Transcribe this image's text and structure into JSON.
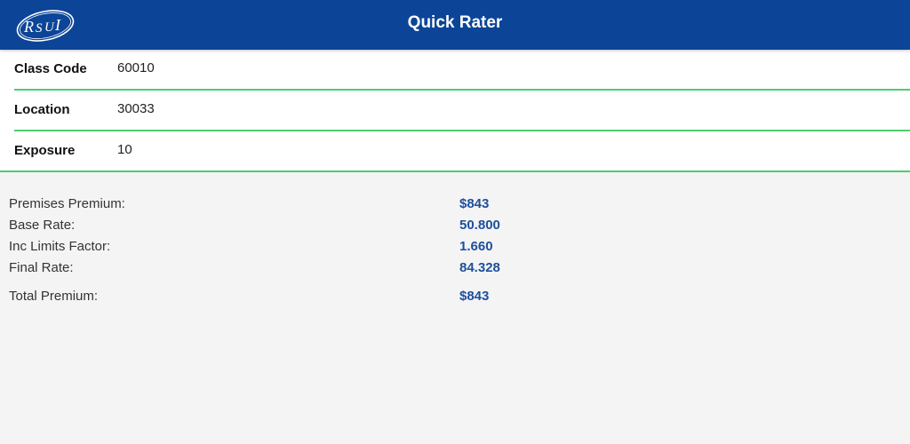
{
  "header": {
    "logo_text": "RSUI",
    "title": "Quick Rater"
  },
  "inputs": [
    {
      "label": "Class Code",
      "value": "60010"
    },
    {
      "label": "Location",
      "value": "30033"
    },
    {
      "label": "Exposure",
      "value": "10"
    }
  ],
  "results": {
    "premises_premium": {
      "label": "Premises Premium:",
      "value": "$843"
    },
    "base_rate": {
      "label": "Base Rate:",
      "value": "50.800"
    },
    "inc_limits_factor": {
      "label": "Inc Limits Factor:",
      "value": "1.660"
    },
    "final_rate": {
      "label": "Final Rate:",
      "value": "84.328"
    },
    "total_premium": {
      "label": "Total Premium:",
      "value": "$843"
    }
  },
  "colors": {
    "header_bg": "#0c4597",
    "divider": "#4cce6f",
    "value_text": "#1d4f9e"
  }
}
